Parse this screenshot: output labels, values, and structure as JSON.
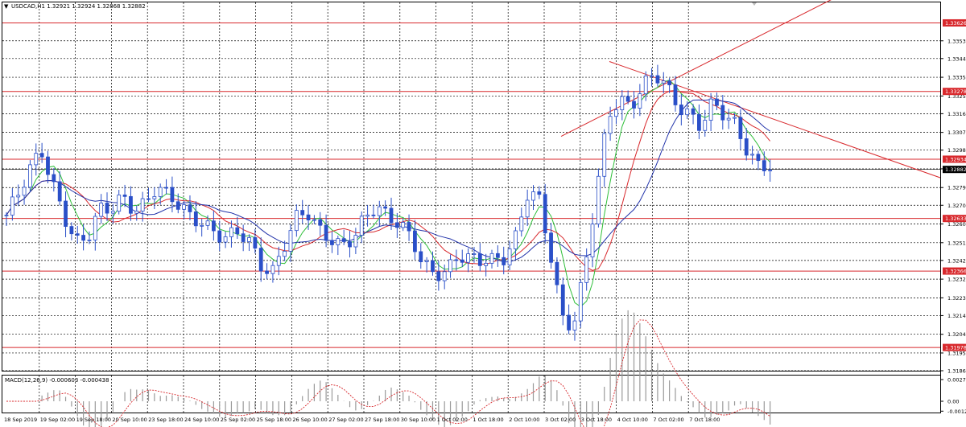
{
  "header": {
    "symbol_line": "USDCAD,H1  1.32921 1.32924 1.32868 1.32882"
  },
  "macd": {
    "label": "MACD(12,26,9) -0.000603 -0.000438",
    "ticks": [
      "0.0027",
      "0.00",
      "-0.00123"
    ],
    "range": [
      -0.0014,
      0.0032
    ]
  },
  "colors": {
    "candle": "#2a4fc8",
    "level": "#d8282c",
    "ma_fast": "#2fbf3a",
    "ma_mid": "#d8282c",
    "ma_slow": "#2233aa",
    "grid": "#000000"
  },
  "chart_data": {
    "type": "candlestick",
    "grid": true,
    "ylim": [
      1.3186,
      1.3373
    ],
    "price_ticks": [
      "1.33535",
      "1.33445",
      "1.33350",
      "1.33255",
      "1.33165",
      "1.33070",
      "1.32980",
      "1.32885",
      "1.32790",
      "1.32700",
      "1.32605",
      "1.32510",
      "1.32420",
      "1.32325",
      "1.32230",
      "1.32140",
      "1.32045",
      "1.31950",
      "1.31860"
    ],
    "time_labels": [
      "18 Sep 2019",
      "19 Sep 02:00",
      "19 Sep 18:00",
      "20 Sep 10:00",
      "23 Sep 18:00",
      "24 Sep 10:00",
      "25 Sep 02:00",
      "25 Sep 18:00",
      "26 Sep 10:00",
      "27 Sep 02:00",
      "27 Sep 18:00",
      "30 Sep 10:00",
      "1 Oct 02:00",
      "1 Oct 18:00",
      "2 Oct 10:00",
      "3 Oct 02:00",
      "3 Oct 18:00",
      "4 Oct 10:00",
      "7 Oct 02:00",
      "7 Oct 18:00"
    ],
    "levels": [
      {
        "label": "1.33626",
        "value": 1.33626
      },
      {
        "label": "1.33278",
        "value": 1.33278
      },
      {
        "label": "1.32934",
        "value": 1.32934
      },
      {
        "label": "1.32633",
        "value": 1.32633
      },
      {
        "label": "1.32366",
        "value": 1.32366
      },
      {
        "label": "1.31978",
        "value": 1.31978
      }
    ],
    "current_price": {
      "label": "1.32882",
      "value": 1.32882
    },
    "close": [
      1.3263,
      1.3275,
      1.329,
      1.33,
      1.328,
      1.3262,
      1.325,
      1.3255,
      1.327,
      1.3268,
      1.3272,
      1.3266,
      1.3272,
      1.3282,
      1.3275,
      1.3268,
      1.3262,
      1.3262,
      1.3258,
      1.3254,
      1.3255,
      1.325,
      1.324,
      1.3238,
      1.325,
      1.3262,
      1.3265,
      1.3258,
      1.3255,
      1.325,
      1.3252,
      1.3262,
      1.327,
      1.3266,
      1.3262,
      1.3252,
      1.3238,
      1.3235,
      1.3238,
      1.3246,
      1.3242,
      1.324,
      1.3242,
      1.3245,
      1.3255,
      1.3275,
      1.3272,
      1.3245,
      1.3215,
      1.321,
      1.3238,
      1.3275,
      1.3315,
      1.3325,
      1.3322,
      1.333,
      1.3335,
      1.333,
      1.3322,
      1.3318,
      1.331,
      1.332,
      1.3315,
      1.3312,
      1.33,
      1.329,
      1.3288
    ]
  }
}
